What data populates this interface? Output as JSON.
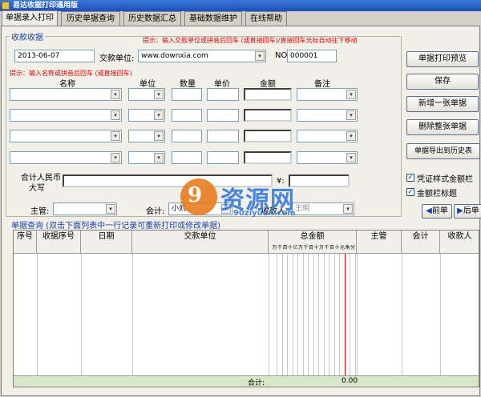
{
  "window": {
    "title": "易达收据打印通用版"
  },
  "tabs": [
    {
      "label": "单据录入打印"
    },
    {
      "label": "历史单据查询"
    },
    {
      "label": "历史数据汇总"
    },
    {
      "label": "基础数据维护"
    },
    {
      "label": "在线帮助"
    }
  ],
  "receipt": {
    "group_title": "收款收据",
    "hint_top": "提示：输入交款单位或拼音后回车 (或直接回车)/直接回车光标自动往下移动",
    "date_value": "2013-06-07",
    "payer_label": "交款单位:",
    "payer_value": "www.downxia.com",
    "no_label": "NO.",
    "no_value": "000001",
    "hint_items": "提示：输入名称或拼音后回车 (或直接回车)",
    "headers": {
      "name": "名称",
      "unit": "单位",
      "qty": "数量",
      "price": "单价",
      "amount": "金额",
      "note": "备注"
    },
    "total_label_line1": "合计人民币",
    "total_label_line2": "大写",
    "yen_label": "¥:",
    "manager_label": "主管:",
    "accountant_label": "会计:",
    "accountant_value": "小刘",
    "collector_label": "收款人:",
    "collector_value": "王明"
  },
  "buttons": {
    "preview": "单据打印预览",
    "save": "保存",
    "new": "新增一张单据",
    "delete": "删除整张单据",
    "export": "单据导出到历史表",
    "prev": "前单",
    "next": "后单"
  },
  "checks": [
    {
      "label": "凭证样式金额栏",
      "checked": true
    },
    {
      "label": "金额栏标题",
      "checked": true
    }
  ],
  "watermark": {
    "glyph": "9",
    "word": "资源网",
    "url": "90ziyuan.com"
  },
  "query": {
    "title": "单据查询 (双击下面列表中一行记录可重新打印或修改单据)",
    "columns": [
      "序号",
      "收据序号",
      "日期",
      "交款单位",
      "总金额",
      "主管",
      "会计",
      "收款人"
    ],
    "digits": [
      "万",
      "千",
      "百",
      "十",
      "亿",
      "万",
      "千",
      "百",
      "十",
      "万",
      "千",
      "百",
      "十",
      "元",
      "角",
      "分"
    ],
    "footer_label": "合计:",
    "footer_value": "0.00"
  },
  "colors": {
    "accent": "#1a3fa8",
    "hint": "#e00000",
    "titlebar": "#2b5fc7",
    "grid_footer": "#d6e8c8"
  }
}
